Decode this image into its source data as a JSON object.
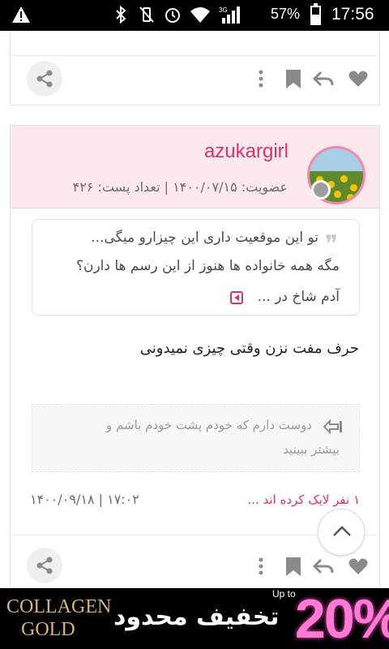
{
  "status_bar": {
    "battery": "57%",
    "time": "17:56",
    "network": "3G",
    "icons": [
      "warning-icon",
      "bluetooth-icon",
      "vibrate-icon",
      "alarm-icon",
      "wifi-icon",
      "signal-icon",
      "battery-icon"
    ],
    "battery_level": 0.57
  },
  "post": {
    "username": "azukargirl",
    "meta": "عضویت: ۱۴۰۰/۰۷/۱۵ | تعداد پست: ۴۲۶",
    "quote": {
      "line1": "تو این موقعیت داری این چیزارو میگی...",
      "line2": "مگه همه خانواده ها هنوز از این رسم ها دارن؟",
      "line3": "آدم شاخ در ..."
    },
    "message": "حرف مفت نزن وقتی چیزی نمیدونی",
    "signature": {
      "line1": "دوست دارم که خودم پشت خودم باشم و",
      "line2": "بیشتر ببینید"
    },
    "likes": "۱ نفر لایک کرده اند ...",
    "date": "۱۴۰۰/۰۹/۱۸ | ۱۷:۰۲"
  },
  "ad": {
    "brand_line1": "COLLAGEN",
    "brand_line2": "GOLD",
    "offer": "تخفیف محدود",
    "upto": "Up to",
    "percent": "20%"
  },
  "colors": {
    "accent": "#d6336c",
    "header_bg": "#fde8ee",
    "icon_gray": "#8a8a8a"
  }
}
